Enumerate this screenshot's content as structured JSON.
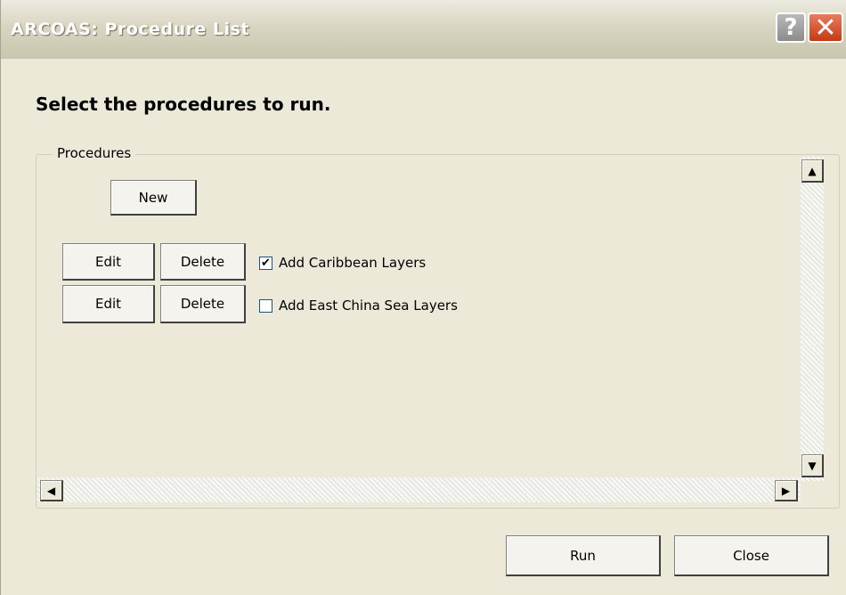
{
  "window": {
    "title": "ARCOAS:  Procedure List",
    "help_glyph": "?",
    "close_glyph": "✕"
  },
  "heading": "Select the procedures to run.",
  "procedures_group": {
    "label": "Procedures",
    "new_button": "New",
    "rows": [
      {
        "edit": "Edit",
        "delete": "Delete",
        "name": "Add Caribbean Layers",
        "checked": true,
        "check_glyph": "✔"
      },
      {
        "edit": "Edit",
        "delete": "Delete",
        "name": "Add East China Sea Layers",
        "checked": false,
        "check_glyph": ""
      }
    ]
  },
  "scrollbars": {
    "up_glyph": "▲",
    "down_glyph": "▼",
    "left_glyph": "◀",
    "right_glyph": "▶"
  },
  "footer": {
    "run_button": "Run",
    "close_button": "Close"
  },
  "colors": {
    "dialog_bg": "#ECE9D8",
    "close_button": "#C63A14",
    "checkbox_border": "#1C5180"
  }
}
